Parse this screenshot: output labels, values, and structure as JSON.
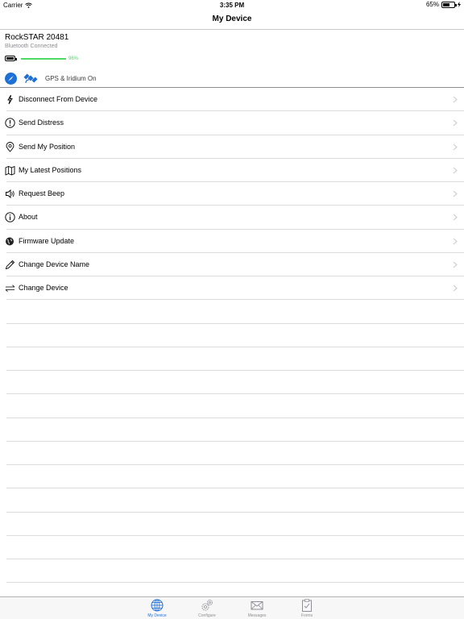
{
  "status_bar": {
    "carrier": "Carrier",
    "time": "3:35 PM",
    "battery": "65%"
  },
  "nav": {
    "title": "My Device"
  },
  "device": {
    "name": "RockSTAR 20481",
    "connection": "Bluetooth Connected",
    "battery_level": "96%",
    "battery_fraction": 0.96,
    "gps_status": "GPS & Iridium On",
    "accent_color": "#1e6fd6",
    "battery_color": "#4cd964"
  },
  "menu": [
    {
      "label": "Disconnect From Device",
      "icon": "lightning-icon"
    },
    {
      "label": "Send Distress",
      "icon": "exclamation-circle-icon"
    },
    {
      "label": "Send My Position",
      "icon": "location-pin-icon"
    },
    {
      "label": "My Latest Positions",
      "icon": "map-icon"
    },
    {
      "label": "Request Beep",
      "icon": "speaker-icon"
    },
    {
      "label": "About",
      "icon": "info-icon"
    },
    {
      "label": "Firmware Update",
      "icon": "globe-pin-icon"
    },
    {
      "label": "Change Device Name",
      "icon": "pencil-icon"
    },
    {
      "label": "Change Device",
      "icon": "swap-arrows-icon"
    }
  ],
  "tabs": [
    {
      "label": "My Device",
      "icon": "globe-icon",
      "active": true
    },
    {
      "label": "Configure",
      "icon": "gears-icon",
      "active": false
    },
    {
      "label": "Messages",
      "icon": "envelope-icon",
      "active": false
    },
    {
      "label": "Forms",
      "icon": "clipboard-icon",
      "active": false
    }
  ]
}
